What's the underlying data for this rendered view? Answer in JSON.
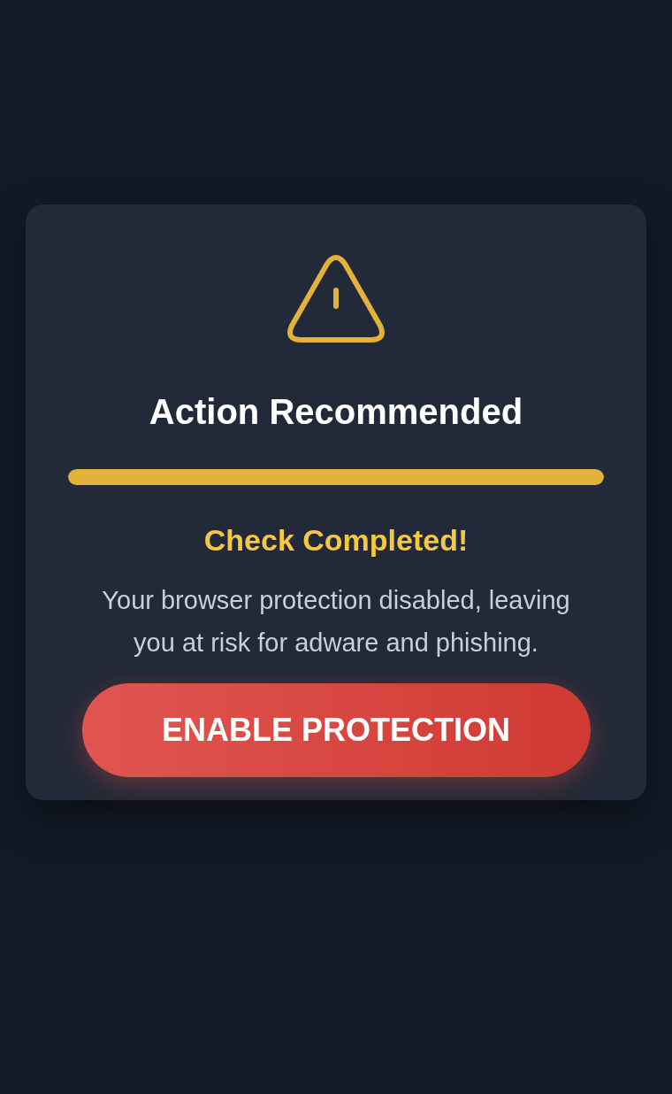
{
  "card": {
    "title": "Action Recommended",
    "progress": {
      "level": 1
    },
    "status": "Check Completed!",
    "message": "Your browser protection disabled, leaving you at risk for adware and phishing.",
    "button": "ENABLE PROTECTION"
  }
}
